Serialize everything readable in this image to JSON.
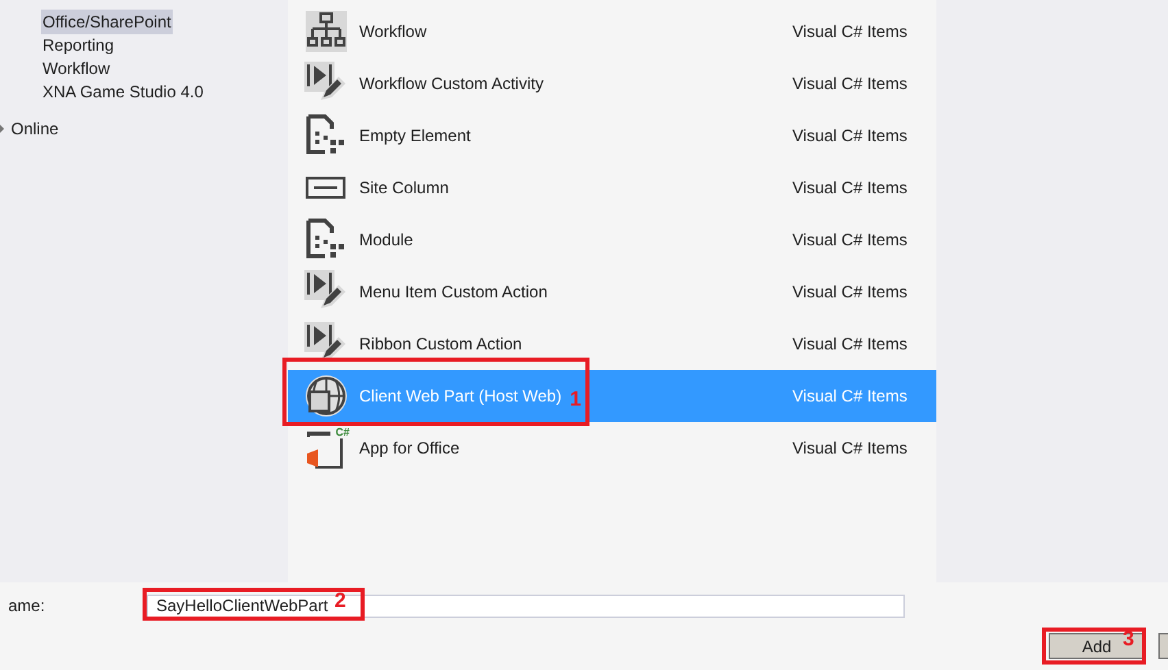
{
  "sidebar": {
    "items": [
      {
        "label": "Office/SharePoint",
        "selected": true
      },
      {
        "label": "Reporting",
        "selected": false
      },
      {
        "label": "Workflow",
        "selected": false
      },
      {
        "label": "XNA Game Studio 4.0",
        "selected": false
      }
    ],
    "online": {
      "label": "Online",
      "expanded": false
    }
  },
  "templates": [
    {
      "kind": "workflow",
      "name": "Workflow",
      "category": "Visual C# Items",
      "selected": false
    },
    {
      "kind": "action",
      "name": "Workflow Custom Activity",
      "category": "Visual C# Items",
      "selected": false
    },
    {
      "kind": "element",
      "name": "Empty Element",
      "category": "Visual C# Items",
      "selected": false
    },
    {
      "kind": "column",
      "name": "Site Column",
      "category": "Visual C# Items",
      "selected": false
    },
    {
      "kind": "element",
      "name": "Module",
      "category": "Visual C# Items",
      "selected": false
    },
    {
      "kind": "action",
      "name": "Menu Item Custom Action",
      "category": "Visual C# Items",
      "selected": false
    },
    {
      "kind": "action",
      "name": "Ribbon Custom Action",
      "category": "Visual C# Items",
      "selected": false
    },
    {
      "kind": "webpart",
      "name": "Client Web Part (Host Web)",
      "category": "Visual C# Items",
      "selected": true,
      "marker": "1"
    },
    {
      "kind": "office",
      "icon_badge": "C#",
      "name": "App for Office",
      "category": "Visual C# Items",
      "selected": false
    }
  ],
  "name_field": {
    "label": "ame:",
    "value": "SayHelloClientWebPart",
    "marker": "2"
  },
  "buttons": [
    {
      "label": "Add",
      "marker": "3"
    }
  ]
}
